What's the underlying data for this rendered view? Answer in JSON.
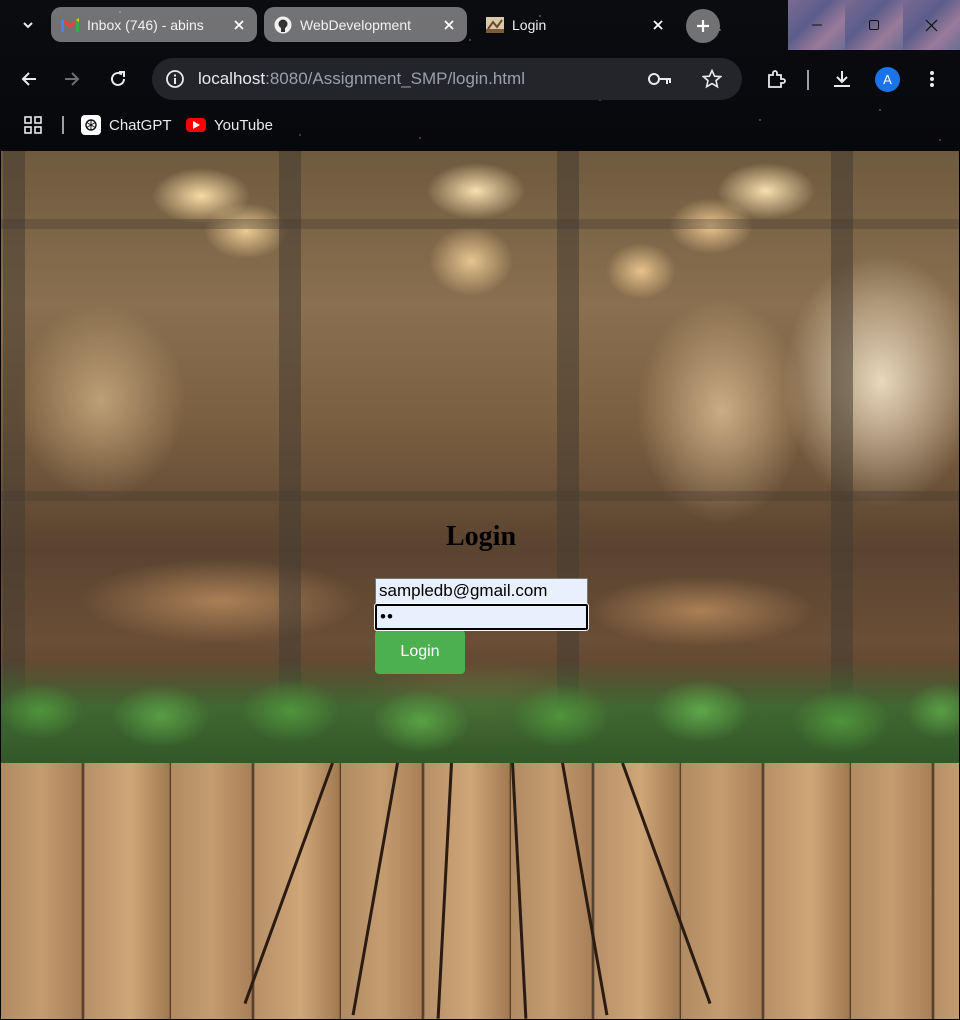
{
  "browser": {
    "tabs": [
      {
        "title": "Inbox (746) - abins",
        "favicon": "gmail-icon",
        "active": false
      },
      {
        "title": "WebDevelopment",
        "favicon": "github-icon",
        "active": false
      },
      {
        "title": "Login",
        "favicon": "page-icon",
        "active": true
      }
    ],
    "url": {
      "host": "localhost",
      "path": ":8080/Assignment_SMP/login.html"
    },
    "profile_initial": "A",
    "bookmarks": [
      {
        "label": "ChatGPT",
        "icon": "chatgpt-icon"
      },
      {
        "label": "YouTube",
        "icon": "youtube-icon"
      }
    ]
  },
  "page": {
    "title": "Login",
    "email_value": "sampledb@gmail.com",
    "password_display": "••",
    "login_button": "Login"
  },
  "colors": {
    "login_button_bg": "#4caf50",
    "avatar_bg": "#1a73e8",
    "autofill_bg": "#e8f0fe"
  }
}
